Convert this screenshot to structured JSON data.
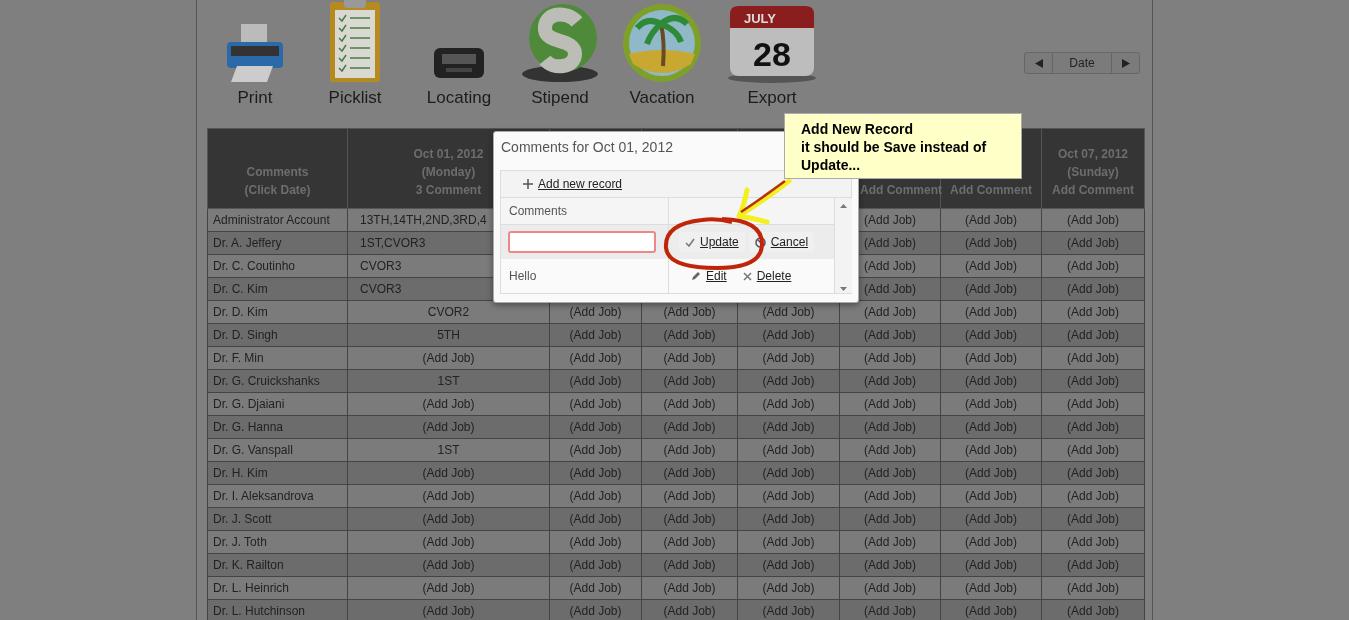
{
  "toolbar": [
    {
      "label": "Print",
      "kind": "printer"
    },
    {
      "label": "Picklist",
      "kind": "clipboard"
    },
    {
      "label": "Locating",
      "kind": "pager"
    },
    {
      "label": "Stipend",
      "kind": "dollar"
    },
    {
      "label": "Vacation",
      "kind": "palm"
    },
    {
      "label": "Export",
      "kind": "calendar",
      "month": "JULY",
      "day": "28"
    }
  ],
  "date_nav": {
    "label": "Date"
  },
  "table": {
    "columns": [
      [
        "Comments",
        "(Click Date)"
      ],
      [
        "Oct 01, 2012",
        "(Monday)",
        "3 Comment"
      ],
      null,
      null,
      null,
      [
        "Add Comment"
      ],
      [
        "Add Comment"
      ],
      [
        "Oct 07, 2012",
        "(Sunday)",
        "Add Comment"
      ]
    ],
    "rows": [
      {
        "cells": [
          "Administrator Account",
          "13TH,14TH,2ND,3RD,4",
          null,
          null,
          null,
          "(Add Job)",
          "(Add Job)",
          "(Add Job)"
        ]
      },
      {
        "cells": [
          "Dr. A. Jeffery",
          "1ST,CVOR3",
          null,
          null,
          null,
          "(Add Job)",
          "(Add Job)",
          "(Add Job)"
        ]
      },
      {
        "cells": [
          "Dr. C. Coutinho",
          "CVOR3",
          null,
          null,
          null,
          "(Add Job)",
          "(Add Job)",
          "(Add Job)"
        ]
      },
      {
        "cells": [
          "Dr. C. Kim",
          "CVOR3",
          null,
          null,
          null,
          "(Add Job)",
          "(Add Job)",
          "(Add Job)"
        ]
      },
      {
        "cells": [
          "Dr. D. Kim",
          "CVOR2",
          "(Add Job)",
          "(Add Job)",
          "(Add Job)",
          "(Add Job)",
          "(Add Job)",
          "(Add Job)"
        ]
      },
      {
        "cells": [
          "Dr. D. Singh",
          "5TH",
          "(Add Job)",
          "(Add Job)",
          "(Add Job)",
          "(Add Job)",
          "(Add Job)",
          "(Add Job)"
        ]
      },
      {
        "cells": [
          "Dr. F. Min",
          "(Add Job)",
          "(Add Job)",
          "(Add Job)",
          "(Add Job)",
          "(Add Job)",
          "(Add Job)",
          "(Add Job)"
        ]
      },
      {
        "cells": [
          "Dr. G. Cruickshanks",
          "1ST",
          "(Add Job)",
          "(Add Job)",
          "(Add Job)",
          "(Add Job)",
          "(Add Job)",
          "(Add Job)"
        ]
      },
      {
        "cells": [
          "Dr. G. Djaiani",
          "(Add Job)",
          "(Add Job)",
          "(Add Job)",
          "(Add Job)",
          "(Add Job)",
          "(Add Job)",
          "(Add Job)"
        ]
      },
      {
        "cells": [
          "Dr. G. Hanna",
          "(Add Job)",
          "(Add Job)",
          "(Add Job)",
          "(Add Job)",
          "(Add Job)",
          "(Add Job)",
          "(Add Job)"
        ]
      },
      {
        "cells": [
          "Dr. G. Vanspall",
          "1ST",
          "(Add Job)",
          "(Add Job)",
          "(Add Job)",
          "(Add Job)",
          "(Add Job)",
          "(Add Job)"
        ]
      },
      {
        "cells": [
          "Dr. H. Kim",
          "(Add Job)",
          "(Add Job)",
          "(Add Job)",
          "(Add Job)",
          "(Add Job)",
          "(Add Job)",
          "(Add Job)"
        ]
      },
      {
        "cells": [
          "Dr. I. Aleksandrova",
          "(Add Job)",
          "(Add Job)",
          "(Add Job)",
          "(Add Job)",
          "(Add Job)",
          "(Add Job)",
          "(Add Job)"
        ]
      },
      {
        "cells": [
          "Dr. J. Scott",
          "(Add Job)",
          "(Add Job)",
          "(Add Job)",
          "(Add Job)",
          "(Add Job)",
          "(Add Job)",
          "(Add Job)"
        ]
      },
      {
        "cells": [
          "Dr. J. Toth",
          "(Add Job)",
          "(Add Job)",
          "(Add Job)",
          "(Add Job)",
          "(Add Job)",
          "(Add Job)",
          "(Add Job)"
        ]
      },
      {
        "cells": [
          "Dr. K. Railton",
          "(Add Job)",
          "(Add Job)",
          "(Add Job)",
          "(Add Job)",
          "(Add Job)",
          "(Add Job)",
          "(Add Job)"
        ]
      },
      {
        "cells": [
          "Dr. L. Heinrich",
          "(Add Job)",
          "(Add Job)",
          "(Add Job)",
          "(Add Job)",
          "(Add Job)",
          "(Add Job)",
          "(Add Job)"
        ]
      },
      {
        "cells": [
          "Dr. L. Hutchinson",
          "(Add Job)",
          "(Add Job)",
          "(Add Job)",
          "(Add Job)",
          "(Add Job)",
          "(Add Job)",
          "(Add Job)"
        ]
      }
    ]
  },
  "dialog": {
    "title": "Comments for Oct 01, 2012",
    "add_label": "Add new record",
    "column": "Comments",
    "rows": [
      {
        "kind": "editing",
        "value": "",
        "actions": [
          "Update",
          "Cancel"
        ]
      },
      {
        "kind": "view",
        "value": "Hello",
        "actions": [
          "Edit",
          "Delete"
        ]
      }
    ]
  },
  "callout": {
    "lines": [
      "Add New Record",
      "it should be Save instead of",
      "Update..."
    ]
  }
}
